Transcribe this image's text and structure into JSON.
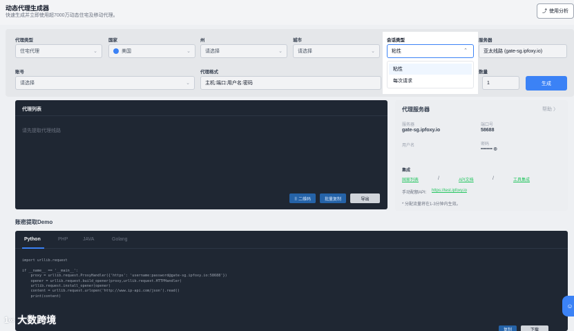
{
  "header": {
    "title": "动态代理生成器",
    "subtitle": "快速生成并立即使用超7000万动态住宅及移动代理。",
    "usage_button": "使用分析"
  },
  "form": {
    "proxy_type": {
      "label": "代理类型",
      "value": "住宅代理"
    },
    "country": {
      "label": "国家",
      "value": "美国"
    },
    "state": {
      "label": "州",
      "value": "请选择"
    },
    "city": {
      "label": "城市",
      "value": "请选择"
    },
    "session_type": {
      "label": "会话类型",
      "value": "粘性",
      "options": [
        "粘性",
        "每次请求"
      ]
    },
    "server": {
      "label": "服务器",
      "value": "亚太线路 (gate-sg.ipfoxy.io)"
    },
    "account": {
      "label": "账号",
      "value": "请选择"
    },
    "proxy_format": {
      "label": "代理格式",
      "value": "主机:端口:用户名:密码"
    },
    "quantity": {
      "label": "数量",
      "value": "1"
    },
    "generate_button": "生成"
  },
  "proxy_list": {
    "title": "代理列表",
    "placeholder": "请先提取代理线路",
    "qr_button": "⠿ 二维码",
    "copy_button": "批量复制",
    "export_button": "导出"
  },
  "server_card": {
    "title": "代理服务器",
    "more": "帮助 〉",
    "server_label": "服务器",
    "server_value": "gate-sg.ipfoxy.io",
    "port_label": "端口号",
    "port_value": "58688",
    "user_label": "用户名",
    "password_label": "密码",
    "password_value": "•••••••• ◎",
    "integration_label": "集成",
    "links": [
      "国家列表",
      "API文档",
      "工具集成"
    ],
    "slash": "/",
    "api_label": "手动配额API:",
    "api_value": "https://test.ipfoxy.io",
    "note": "* 分配流量将在1-3分钟内生效。"
  },
  "demo": {
    "title": "账密提取Demo",
    "tabs": [
      "Python",
      "PHP",
      "JAVA",
      "Golang"
    ],
    "code_lines": [
      "import urllib.request",
      "",
      "if __name__ == '__main__':",
      "    proxy = urllib.request.ProxyHandler({'https': 'username:password@gate-sg.ipfoxy.io:58688'})",
      "    opener = urllib.request.build_opener(proxy,urllib.request.HTTPHandler)",
      "    urllib.request.install_opener(opener)",
      "    content = urllib.request.urlopen('http://www.ip-api.com/json').read()",
      "    print(content)"
    ],
    "copy_button": "复制",
    "download_button": "下载"
  },
  "logo": {
    "mark": "1∞",
    "name": "大数跨境"
  },
  "colors": {
    "accent": "#3b82f6",
    "dark_panel": "#1f2733",
    "link_green": "#22c55e"
  }
}
